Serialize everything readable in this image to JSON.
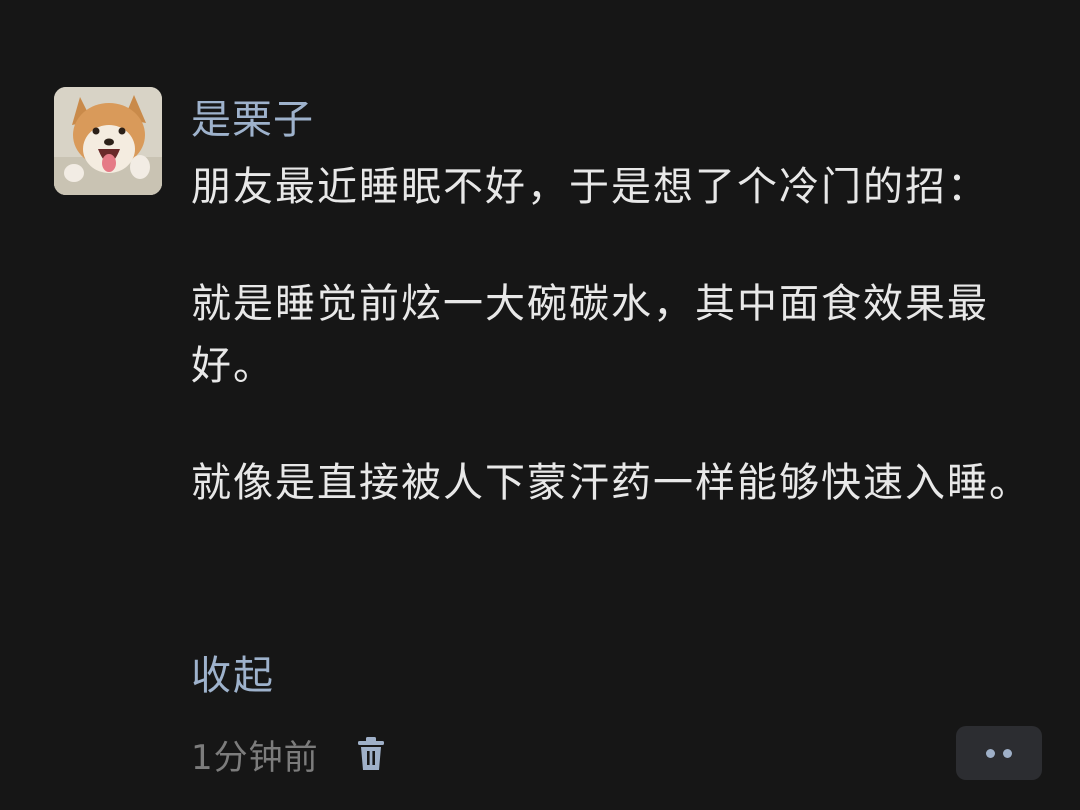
{
  "comment": {
    "avatar_icon": "shiba-dog-avatar",
    "username": "是栗子",
    "paragraphs": [
      "朋友最近睡眠不好，于是想了个冷门的招：",
      "就是睡觉前炫一大碗碳水，其中面食效果最好。",
      "就像是直接被人下蒙汗药一样能够快速入睡。"
    ],
    "collapse_label": "收起",
    "timestamp": "1分钟前",
    "delete_icon": "trash-icon",
    "more_icon": "more-dots-icon"
  },
  "colors": {
    "background": "#161616",
    "link": "#9eb2cc",
    "text": "#e8e8e8",
    "muted": "#7c7c7c",
    "button_bg": "#2c2d31"
  }
}
